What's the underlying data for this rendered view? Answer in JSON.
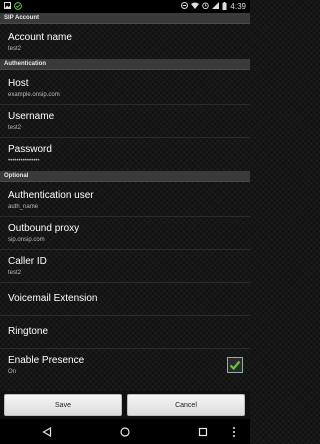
{
  "status_bar": {
    "time": "4:39",
    "left_icons": [
      "gallery-icon",
      "sync-check-icon"
    ],
    "right_icons": [
      "do-not-disturb-icon",
      "wifi-icon",
      "alarm-icon",
      "signal-icon",
      "battery-icon"
    ]
  },
  "sections": {
    "sip_account": "SIP Account",
    "authentication": "Authentication",
    "optional": "Optional"
  },
  "prefs": {
    "account_name": {
      "title": "Account name",
      "summary": "test2"
    },
    "host": {
      "title": "Host",
      "summary": "example.onsip.com"
    },
    "username": {
      "title": "Username",
      "summary": "test2"
    },
    "password": {
      "title": "Password",
      "summary": "•••••••••••••••"
    },
    "auth_user": {
      "title": "Authentication user",
      "summary": "auth_name"
    },
    "outbound_proxy": {
      "title": "Outbound proxy",
      "summary": "sip.onsip.com"
    },
    "caller_id": {
      "title": "Caller ID",
      "summary": "test2"
    },
    "voicemail": {
      "title": "Voicemail Extension"
    },
    "ringtone": {
      "title": "Ringtone"
    },
    "presence": {
      "title": "Enable Presence",
      "summary": "On",
      "checked": true
    }
  },
  "buttons": {
    "save": "Save",
    "cancel": "Cancel"
  },
  "colors": {
    "accent_check": "#6bc04b",
    "section_bg": "#3a3a3a"
  }
}
